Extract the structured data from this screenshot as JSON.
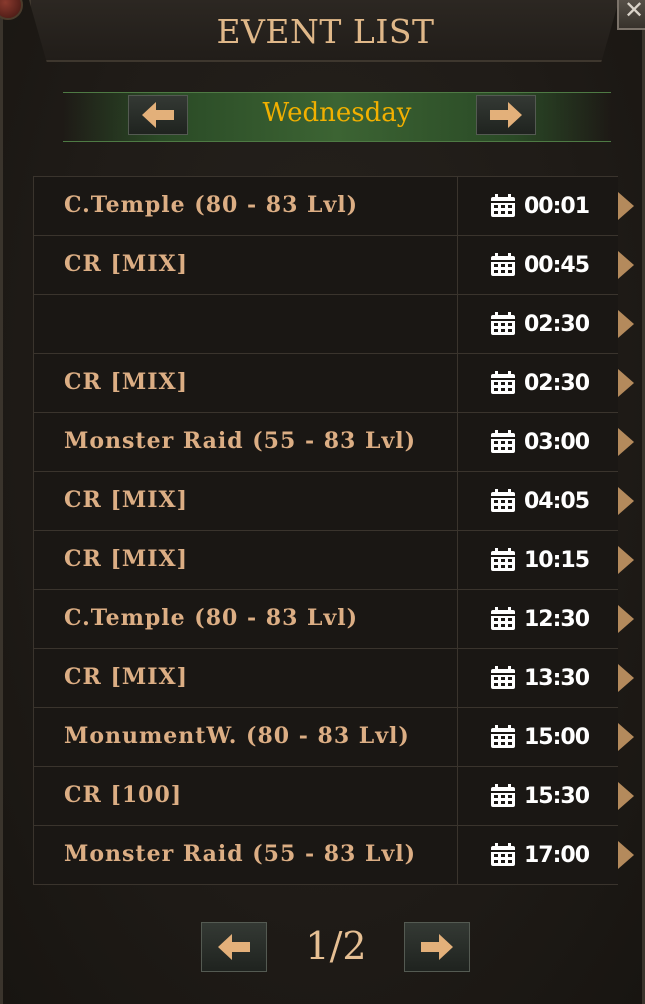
{
  "window": {
    "title": "EVENT LIST",
    "close_glyph": "✕"
  },
  "day_selector": {
    "day": "Wednesday"
  },
  "events": [
    {
      "name": "C.Temple (80 - 83 Lvl)",
      "time": "00:01"
    },
    {
      "name": "CR [MIX]",
      "time": "00:45"
    },
    {
      "name": "",
      "time": "02:30"
    },
    {
      "name": "CR [MIX]",
      "time": "02:30"
    },
    {
      "name": "Monster Raid (55 - 83 Lvl)",
      "time": "03:00"
    },
    {
      "name": "CR [MIX]",
      "time": "04:05"
    },
    {
      "name": "CR [MIX]",
      "time": "10:15"
    },
    {
      "name": "C.Temple (80 - 83 Lvl)",
      "time": "12:30"
    },
    {
      "name": "CR [MIX]",
      "time": "13:30"
    },
    {
      "name": "MonumentW. (80 - 83 Lvl)",
      "time": "15:00"
    },
    {
      "name": "CR [100]",
      "time": "15:30"
    },
    {
      "name": "Monster Raid (55 - 83 Lvl)",
      "time": "17:00"
    }
  ],
  "pagination": {
    "label": "1/2"
  },
  "colors": {
    "accent_gold": "#f2b000",
    "text_tan": "#dcae84",
    "arrow": "#b48a5c"
  },
  "icons": {
    "prev": "arrow-left-icon",
    "next": "arrow-right-icon",
    "time": "calendar-icon",
    "close": "close-icon"
  }
}
